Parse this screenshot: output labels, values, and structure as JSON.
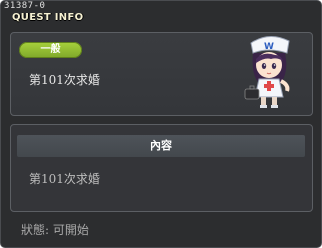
{
  "window": {
    "quest_id": "31387-0",
    "title": "QUEST INFO"
  },
  "quest": {
    "category": "一般",
    "name": "第101次求婚"
  },
  "content": {
    "header": "內容",
    "text": "第101次求婚"
  },
  "status": {
    "label": "狀態: 可開始"
  },
  "colors": {
    "window_bg": "#2c2d2f",
    "badge_green": "#8fbc30",
    "title_text": "#f6f1d2",
    "header_bg": "#4a4f55"
  },
  "icons": {
    "npc": "nurse-npc-portrait"
  }
}
